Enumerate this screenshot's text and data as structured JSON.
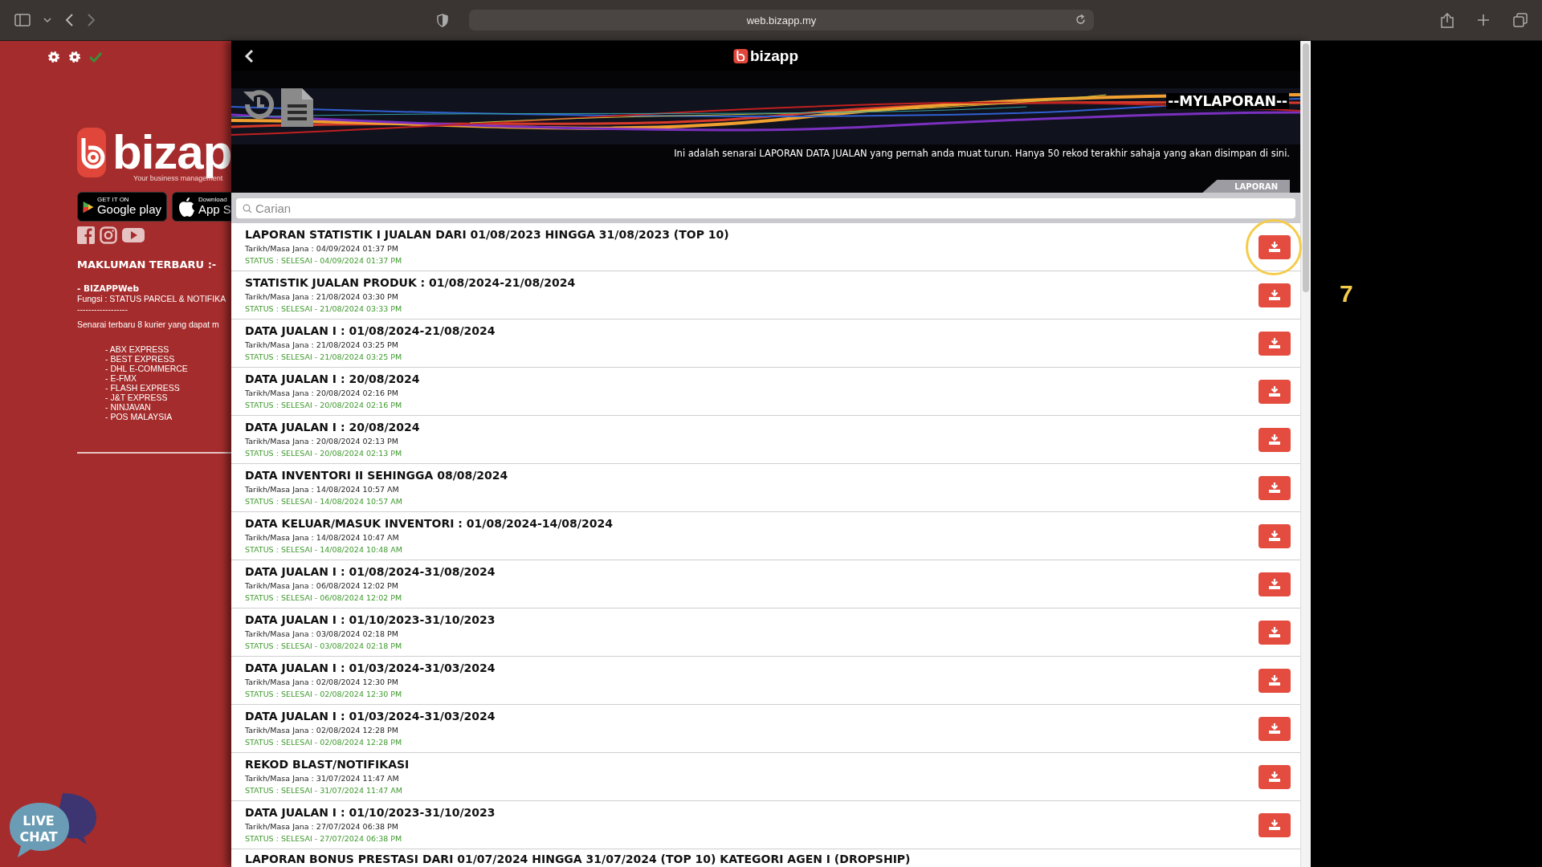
{
  "browser": {
    "url": "web.bizapp.my"
  },
  "sidebar": {
    "logo_text": "bizap",
    "tagline": "Your business management",
    "store_badges": [
      {
        "kind": "google",
        "line1": "GET IT ON",
        "line2": "Google play"
      },
      {
        "kind": "apple",
        "line1": "Download",
        "line2": "App S"
      }
    ],
    "notice_title": "MAKLUMAN TERBARU :-",
    "notice_lines": [
      {
        "kind": "heading",
        "text": "- BIZAPPWeb"
      },
      {
        "kind": "plain",
        "text": "Fungsi : STATUS PARCEL & NOTIFIKA"
      },
      {
        "kind": "plain",
        "text": "------------------"
      },
      {
        "kind": "plain",
        "text": "Senarai terbaru 8 kurier yang dapat m"
      }
    ],
    "couriers": [
      "- ABX EXPRESS",
      "- BEST EXPRESS",
      "- DHL E-COMMERCE",
      "- E-FMX",
      "- FLASH EXPRESS",
      "- J&T EXPRESS",
      "- NINJAVAN",
      "- POS MALAYSIA"
    ],
    "live_chat": [
      "LIVE",
      "CHAT"
    ]
  },
  "header": {
    "logo_text": "bizapp",
    "title": "--MYLAPORAN--",
    "description": "Ini adalah senarai LAPORAN DATA JUALAN yang pernah anda muat turun. Hanya 50 rekod terakhir sahaja yang akan disimpan di sini.",
    "tab": "LAPORAN"
  },
  "search": {
    "placeholder": "Carian"
  },
  "reports": [
    {
      "title": "LAPORAN STATISTIK I JUALAN DARI 01/08/2023 HINGGA 31/08/2023 (TOP 10)",
      "generated": "Tarikh/Masa Jana : 04/09/2024 01:37 PM",
      "status": "STATUS : SELESAI - 04/09/2024 01:37 PM",
      "circled": true
    },
    {
      "title": "STATISTIK JUALAN PRODUK : 01/08/2024-21/08/2024",
      "generated": "Tarikh/Masa Jana : 21/08/2024 03:30 PM",
      "status": "STATUS : SELESAI - 21/08/2024 03:33 PM",
      "circled": false
    },
    {
      "title": "DATA JUALAN I : 01/08/2024-21/08/2024",
      "generated": "Tarikh/Masa Jana : 21/08/2024 03:25 PM",
      "status": "STATUS : SELESAI - 21/08/2024 03:25 PM",
      "circled": false
    },
    {
      "title": "DATA JUALAN I : 20/08/2024",
      "generated": "Tarikh/Masa Jana : 20/08/2024 02:16 PM",
      "status": "STATUS : SELESAI - 20/08/2024 02:16 PM",
      "circled": false
    },
    {
      "title": "DATA JUALAN I : 20/08/2024",
      "generated": "Tarikh/Masa Jana : 20/08/2024 02:13 PM",
      "status": "STATUS : SELESAI - 20/08/2024 02:13 PM",
      "circled": false
    },
    {
      "title": "DATA INVENTORI II SEHINGGA 08/08/2024",
      "generated": "Tarikh/Masa Jana : 14/08/2024 10:57 AM",
      "status": "STATUS : SELESAI - 14/08/2024 10:57 AM",
      "circled": false
    },
    {
      "title": "DATA KELUAR/MASUK INVENTORI : 01/08/2024-14/08/2024",
      "generated": "Tarikh/Masa Jana : 14/08/2024 10:47 AM",
      "status": "STATUS : SELESAI - 14/08/2024 10:48 AM",
      "circled": false
    },
    {
      "title": "DATA JUALAN I : 01/08/2024-31/08/2024",
      "generated": "Tarikh/Masa Jana : 06/08/2024 12:02 PM",
      "status": "STATUS : SELESAI - 06/08/2024 12:02 PM",
      "circled": false
    },
    {
      "title": "DATA JUALAN I : 01/10/2023-31/10/2023",
      "generated": "Tarikh/Masa Jana : 03/08/2024 02:18 PM",
      "status": "STATUS : SELESAI - 03/08/2024 02:18 PM",
      "circled": false
    },
    {
      "title": "DATA JUALAN I : 01/03/2024-31/03/2024",
      "generated": "Tarikh/Masa Jana : 02/08/2024 12:30 PM",
      "status": "STATUS : SELESAI - 02/08/2024 12:30 PM",
      "circled": false
    },
    {
      "title": "DATA JUALAN I : 01/03/2024-31/03/2024",
      "generated": "Tarikh/Masa Jana : 02/08/2024 12:28 PM",
      "status": "STATUS : SELESAI - 02/08/2024 12:28 PM",
      "circled": false
    },
    {
      "title": "REKOD BLAST/NOTIFIKASI",
      "generated": "Tarikh/Masa Jana : 31/07/2024 11:47 AM",
      "status": "STATUS : SELESAI - 31/07/2024 11:47 AM",
      "circled": false
    },
    {
      "title": "DATA JUALAN I : 01/10/2023-31/10/2023",
      "generated": "Tarikh/Masa Jana : 27/07/2024 06:38 PM",
      "status": "STATUS : SELESAI - 27/07/2024 06:38 PM",
      "circled": false
    },
    {
      "title": "LAPORAN BONUS PRESTASI DARI 01/07/2024 HINGGA 31/07/2024 (TOP 10) KATEGORI AGEN I (DROPSHIP)",
      "circled": false
    }
  ],
  "annotation": {
    "label": "7"
  }
}
